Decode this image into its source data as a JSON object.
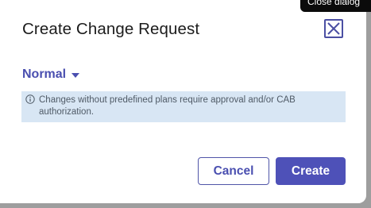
{
  "dialog": {
    "title": "Create Change Request",
    "close_tooltip": "Close dialog",
    "change_type": {
      "selected": "Normal"
    },
    "info_message": "Changes without predefined plans require approval and/or CAB authorization.",
    "buttons": {
      "cancel": "Cancel",
      "create": "Create"
    }
  },
  "icons": {
    "close": "close-icon",
    "dropdown": "caret-down-icon",
    "info": "info-circle-icon"
  },
  "colors": {
    "accent": "#4e51b8",
    "info_background": "#d8e6f4",
    "tooltip_background": "#0b0b0b"
  }
}
